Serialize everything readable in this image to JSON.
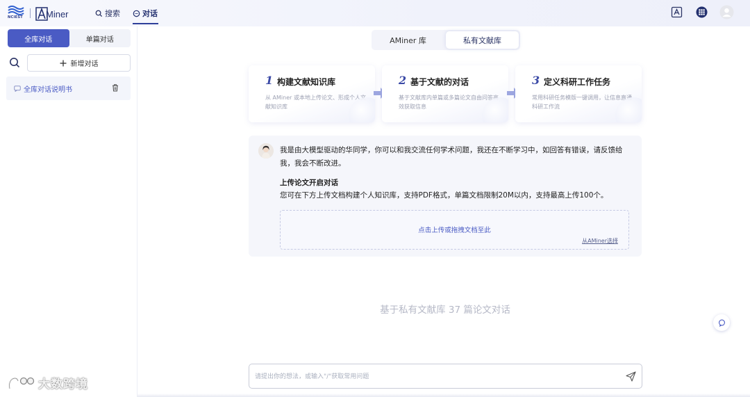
{
  "header": {
    "logo_left_text": "NCIEST",
    "logo_right_text": "Miner",
    "nav": [
      {
        "label": "搜索"
      },
      {
        "label": "对话"
      }
    ]
  },
  "sidebar": {
    "tabs": [
      {
        "label": "全库对话",
        "active": true
      },
      {
        "label": "单篇对话",
        "active": false
      }
    ],
    "new_chat_label": "新增对话",
    "chat_items": [
      {
        "label": "全库对话说明书"
      }
    ]
  },
  "main": {
    "library_tabs": [
      {
        "label": "AMiner 库",
        "active": false
      },
      {
        "label": "私有文献库",
        "active": true
      }
    ],
    "steps": [
      {
        "num": "1",
        "title": "构建文献知识库",
        "desc": "从 AMiner 或本地上传论文、形成个人文献知识库"
      },
      {
        "num": "2",
        "title": "基于文献的对话",
        "desc": "基于文献库内单篇或多篇论文自由问答高效获取信息"
      },
      {
        "num": "3",
        "title": "定义科研工作任务",
        "desc": "常用科研任务模版一键调用，让信息直通科研工作流"
      }
    ],
    "assistant": {
      "message": "我是由大模型驱动的华同学，你可以和我交流任何学术问题，我还在不断学习中，如回答有错误，请反馈给我，我会不断改进。",
      "upload_title": "上传论文开启对话",
      "upload_desc": "您可在下方上传文档构建个人知识库，支持PDF格式，单篇文档限制20M以内，支持最高上传100个。",
      "dropzone_text": "点击上传或拖拽文档至此",
      "dropzone_link": "从AMiner选择"
    },
    "summary": "基于私有文献库 37 篇论文对话",
    "input": {
      "placeholder": "请提出你的想法，或输入\"/\"获取常用问题",
      "value": ""
    }
  },
  "watermark": {
    "text": "大数跨境"
  },
  "colors": {
    "accent": "#4a5bc4",
    "nav_dark": "#23306f"
  }
}
